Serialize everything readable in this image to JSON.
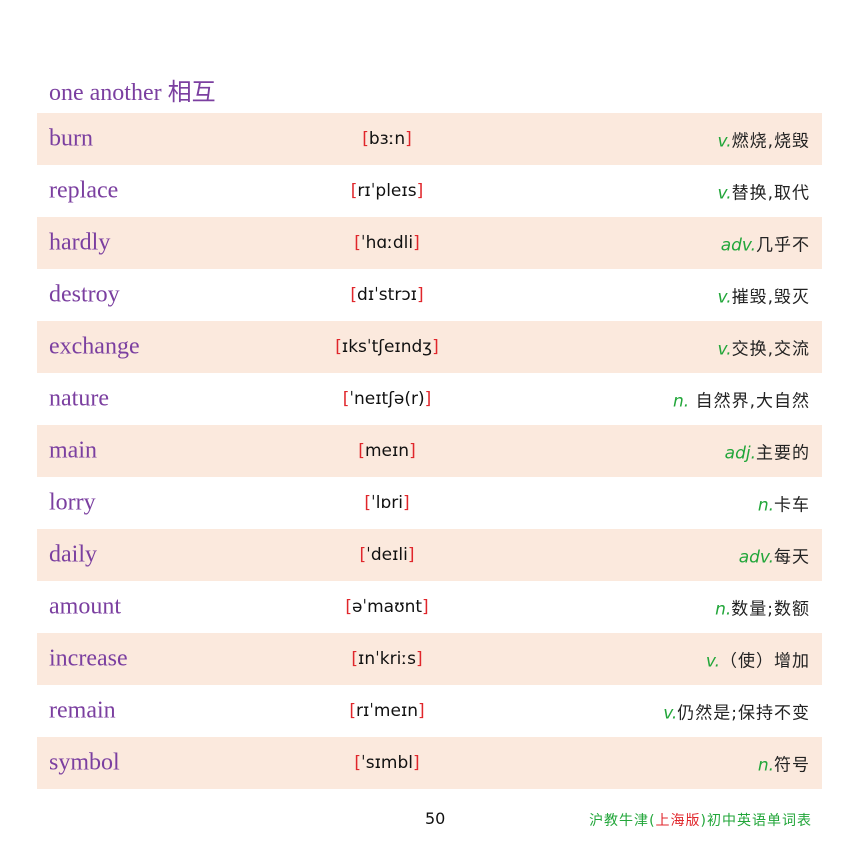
{
  "header": {
    "phrase": "one another",
    "meaning": "相互"
  },
  "words": [
    {
      "word": "burn",
      "phonetic": "bɜːn",
      "pos": "v.",
      "meaning": "燃烧,烧毁"
    },
    {
      "word": "replace",
      "phonetic": "rɪˈpleɪs",
      "pos": "v.",
      "meaning": "替换,取代"
    },
    {
      "word": "hardly",
      "phonetic": "ˈhɑːdli",
      "pos": "adv.",
      "meaning": "几乎不"
    },
    {
      "word": "destroy",
      "phonetic": "dɪˈstrɔɪ",
      "pos": "v.",
      "meaning": "摧毁,毁灭"
    },
    {
      "word": "exchange",
      "phonetic": "ɪksˈtʃeɪndʒ",
      "pos": "v.",
      "meaning": "交换,交流"
    },
    {
      "word": "nature",
      "phonetic": "ˈneɪtʃə(r)",
      "pos": "n.",
      "meaning": " 自然界,大自然"
    },
    {
      "word": "main",
      "phonetic": "meɪn",
      "pos": "adj.",
      "meaning": "主要的"
    },
    {
      "word": "lorry",
      "phonetic": "ˈlɒri",
      "pos": "n.",
      "meaning": "卡车"
    },
    {
      "word": "daily",
      "phonetic": "ˈdeɪli",
      "pos": "adv.",
      "meaning": "每天"
    },
    {
      "word": "amount",
      "phonetic": "əˈmaʊnt",
      "pos": "n.",
      "meaning": "数量;数额"
    },
    {
      "word": "increase",
      "phonetic": "ɪnˈkriːs",
      "pos": "v.",
      "meaning": "（使）增加"
    },
    {
      "word": "remain",
      "phonetic": "rɪˈmeɪn",
      "pos": "v.",
      "meaning": "仍然是;保持不变"
    },
    {
      "word": "symbol",
      "phonetic": "ˈsɪmbl",
      "pos": "n.",
      "meaning": "符号"
    }
  ],
  "footer": {
    "page_number": "50",
    "title_part1": "沪教牛津",
    "title_paren_open": "(",
    "title_edition": "上海版",
    "title_paren_close": ")",
    "title_part2": "初中英语单词表"
  },
  "colors": {
    "word": "#7b3fa0",
    "bracket": "#e0262b",
    "pos": "#22a63a",
    "shaded_row": "#fbe9dd"
  }
}
